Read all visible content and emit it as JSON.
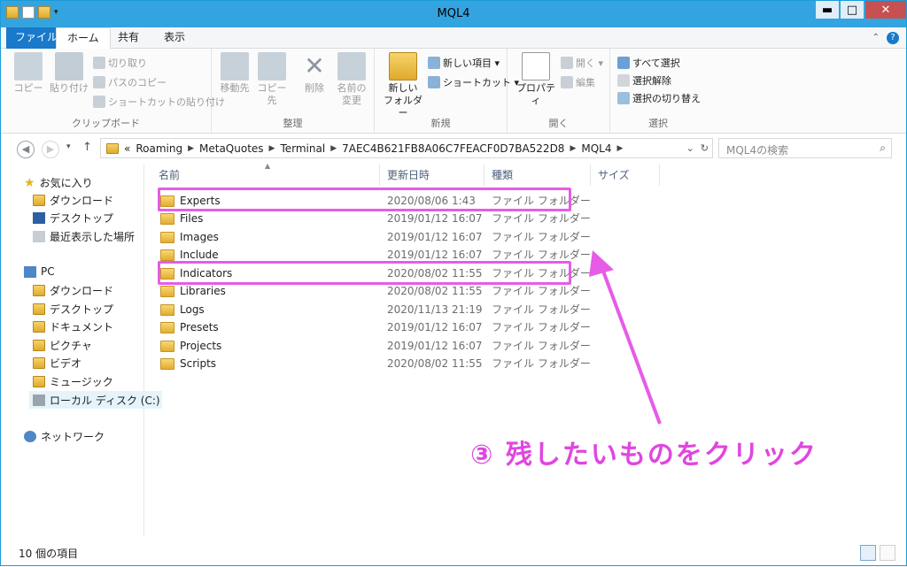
{
  "window": {
    "title": "MQL4",
    "minimize": "▬",
    "maximize": "□",
    "close": "✕"
  },
  "tabs": [
    {
      "label": "ファイル"
    },
    {
      "label": "ホーム"
    },
    {
      "label": "共有"
    },
    {
      "label": "表示"
    }
  ],
  "ribbon": {
    "clipboard": {
      "label": "クリップボード",
      "copy": "コピー",
      "paste": "貼り付け",
      "cut": "切り取り",
      "copy_path": "パスのコピー",
      "paste_shortcut": "ショートカットの貼り付け"
    },
    "organize": {
      "label": "整理",
      "move_to": "移動先",
      "copy_to": "コピー先",
      "delete": "削除",
      "rename_1": "名前の",
      "rename_2": "変更"
    },
    "new": {
      "label": "新規",
      "new_folder_1": "新しい",
      "new_folder_2": "フォルダー",
      "new_item": "新しい項目 ▾",
      "shortcut": "ショートカット ▾"
    },
    "open": {
      "label": "開く",
      "properties": "プロパティ",
      "open": "開く ▾",
      "edit": "編集"
    },
    "select": {
      "label": "選択",
      "select_all": "すべて選択",
      "select_none": "選択解除",
      "invert": "選択の切り替え"
    }
  },
  "address": {
    "crumbs": [
      "«",
      "Roaming",
      "MetaQuotes",
      "Terminal",
      "7AEC4B621FB8A06C7FEACF0D7BA522D8",
      "MQL4"
    ],
    "search_placeholder": "MQL4の検索"
  },
  "nav": {
    "favorites": "お気に入り",
    "fav_items": [
      "ダウンロード",
      "デスクトップ",
      "最近表示した場所"
    ],
    "pc": "PC",
    "pc_items": [
      "ダウンロード",
      "デスクトップ",
      "ドキュメント",
      "ピクチャ",
      "ビデオ",
      "ミュージック",
      "ローカル ディスク (C:)"
    ],
    "network": "ネットワーク"
  },
  "columns": [
    "名前",
    "更新日時",
    "種類",
    "サイズ"
  ],
  "files": [
    {
      "name": "Experts",
      "date": "2020/08/06 1:43",
      "type": "ファイル フォルダー"
    },
    {
      "name": "Files",
      "date": "2019/01/12 16:07",
      "type": "ファイル フォルダー"
    },
    {
      "name": "Images",
      "date": "2019/01/12 16:07",
      "type": "ファイル フォルダー"
    },
    {
      "name": "Include",
      "date": "2019/01/12 16:07",
      "type": "ファイル フォルダー"
    },
    {
      "name": "Indicators",
      "date": "2020/08/02 11:55",
      "type": "ファイル フォルダー"
    },
    {
      "name": "Libraries",
      "date": "2020/08/02 11:55",
      "type": "ファイル フォルダー"
    },
    {
      "name": "Logs",
      "date": "2020/11/13 21:19",
      "type": "ファイル フォルダー"
    },
    {
      "name": "Presets",
      "date": "2019/01/12 16:07",
      "type": "ファイル フォルダー"
    },
    {
      "name": "Projects",
      "date": "2019/01/12 16:07",
      "type": "ファイル フォルダー"
    },
    {
      "name": "Scripts",
      "date": "2020/08/02 11:55",
      "type": "ファイル フォルダー"
    }
  ],
  "status": {
    "count": "10 個の項目"
  },
  "annotation": {
    "text": "③ 残したいものをクリック",
    "color": "#e046e0"
  }
}
